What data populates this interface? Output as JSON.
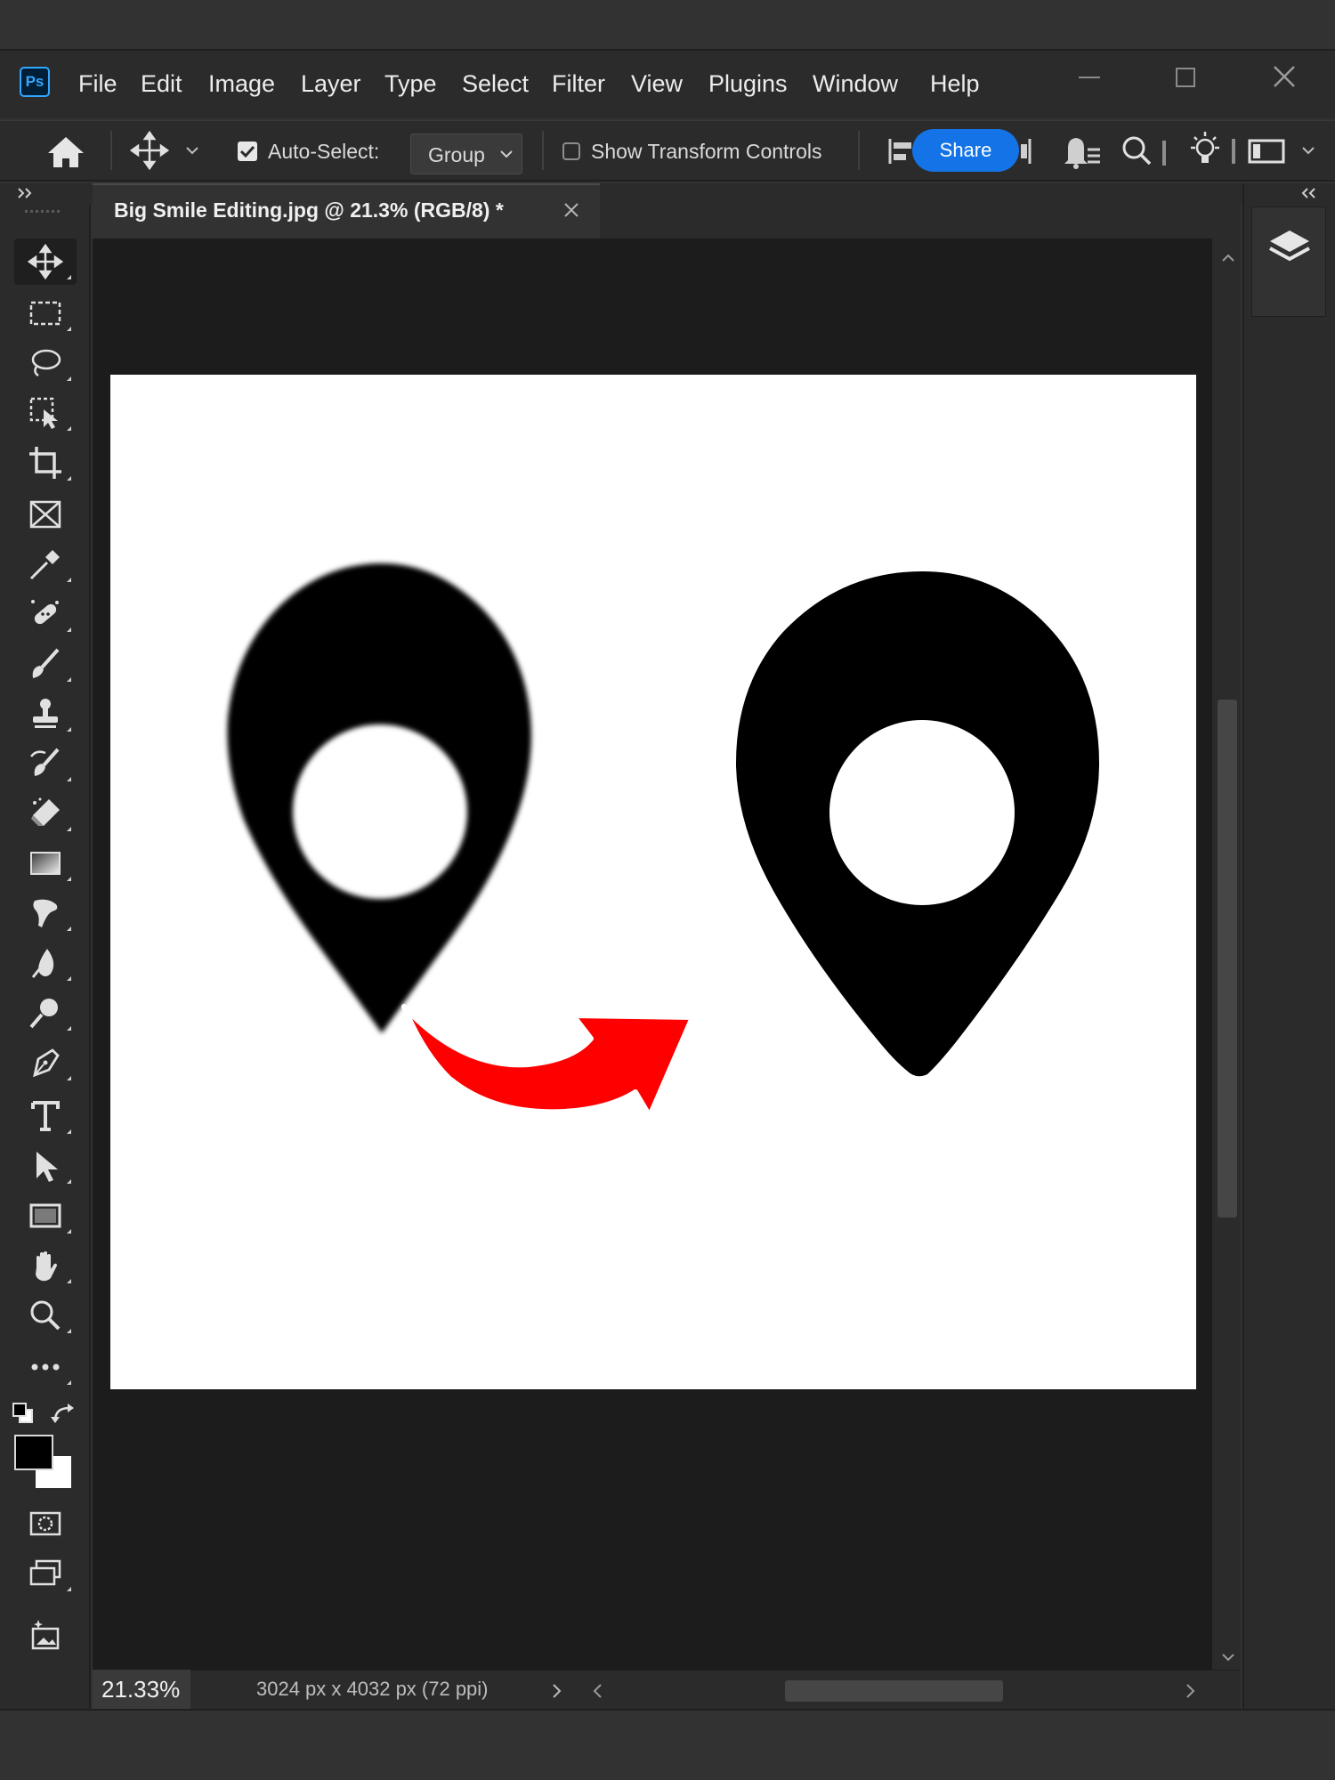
{
  "app": {
    "logo_text": "Ps"
  },
  "menu": {
    "items": [
      "File",
      "Edit",
      "Image",
      "Layer",
      "Type",
      "Select",
      "Filter",
      "View",
      "Plugins",
      "Window",
      "Help"
    ]
  },
  "options": {
    "auto_select_label": "Auto-Select:",
    "auto_select_checked": true,
    "auto_select_target": "Group",
    "transform_controls_label": "Show Transform Controls",
    "transform_controls_checked": false,
    "share_label": "Share"
  },
  "document": {
    "tab_title": "Big Smile Editing.jpg @ 21.3% (RGB/8) *"
  },
  "status": {
    "zoom": "21.33%",
    "doc_info": "3024 px x 4032 px (72 ppi)"
  },
  "colors": {
    "foreground": "#000000",
    "background": "#ffffff",
    "accent": "#1473e6",
    "arrow": "#ff0000"
  },
  "tools": [
    "move-tool",
    "rectangular-marquee-tool",
    "lasso-tool",
    "object-selection-tool",
    "crop-tool",
    "frame-tool",
    "eyedropper-tool",
    "spot-healing-brush-tool",
    "brush-tool",
    "clone-stamp-tool",
    "history-brush-tool",
    "eraser-tool",
    "gradient-tool",
    "smudge-tool",
    "dodge-tool",
    "pen-tool",
    "type-tool",
    "path-selection-tool",
    "rectangle-tool",
    "hand-tool",
    "zoom-tool",
    "edit-toolbar"
  ]
}
